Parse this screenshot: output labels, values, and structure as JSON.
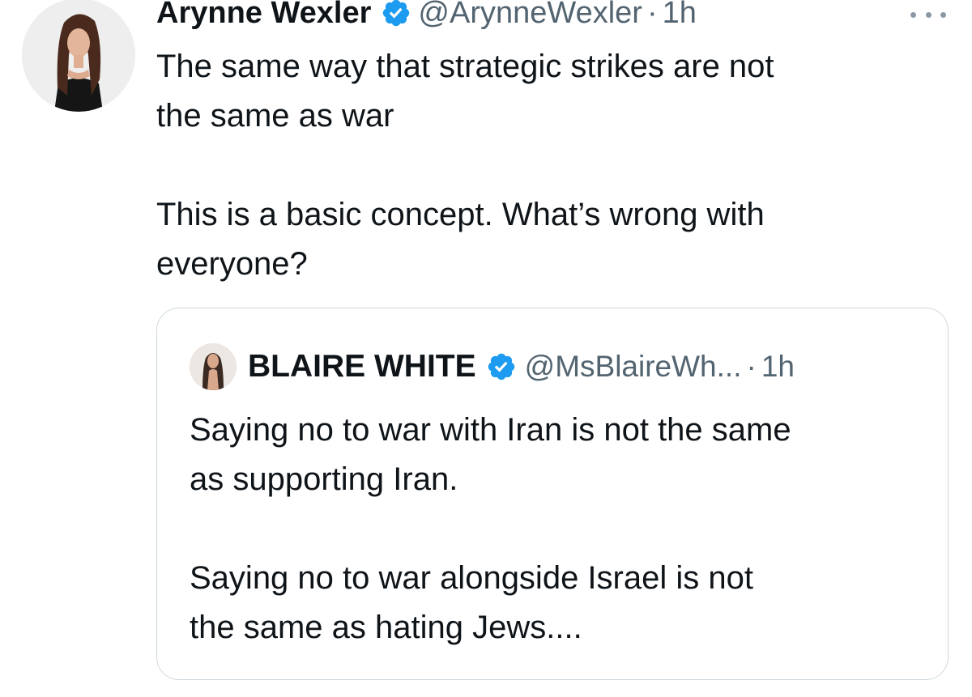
{
  "tweet": {
    "author_name": "Arynne Wexler",
    "author_handle": "@ArynneWexler",
    "separator": "·",
    "time": "1h",
    "lines": [
      "The same way that strategic strikes are not",
      "the same as war",
      "This is a basic concept. What’s wrong with",
      "everyone?"
    ]
  },
  "quote": {
    "author_name": "BLAIRE WHITE",
    "author_handle": "@MsBlaireWh...",
    "separator": "·",
    "time": "1h",
    "lines": [
      "Saying no to war with Iran is not the same",
      "as supporting Iran.",
      "Saying no to war alongside Israel is not",
      "the same as hating Jews...."
    ]
  },
  "colors": {
    "verified": "#1d9bf0",
    "secondary_text": "#536471",
    "primary_text": "#0f1419",
    "border": "#cfd9de"
  },
  "icons": {
    "verified": "verified-badge-icon",
    "more": "more-options-icon"
  }
}
